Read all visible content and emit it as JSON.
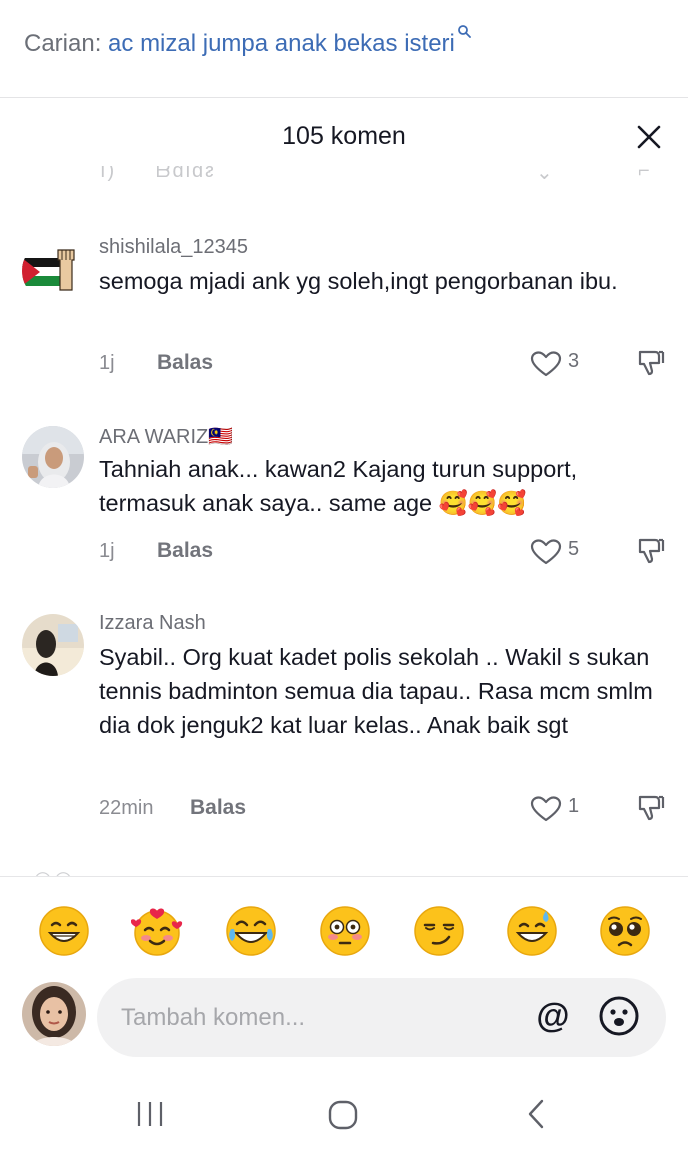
{
  "search": {
    "prefix": "Carian:",
    "query": "ac mizal jumpa anak bekas isteri",
    "icon": "search-icon"
  },
  "sheet": {
    "title": "105 komen",
    "close_icon": "close-icon"
  },
  "comments": [
    {
      "username": "shishilala_12345",
      "text": "semoga mjadi ank yg soleh,ingt pengorbanan ibu.",
      "time": "1j",
      "reply_label": "Balas",
      "likes": "3"
    },
    {
      "username": "ARA WARIZ🇲🇾",
      "text": "Tahniah anak... kawan2 Kajang turun support, termasuk anak saya.. same age 🥰🥰🥰",
      "time": "1j",
      "reply_label": "Balas",
      "likes": "5"
    },
    {
      "username": "Izzara Nash",
      "text": "Syabil.. Org kuat kadet polis sekolah .. Wakil s sukan tennis badminton semua dia tapau.. Rasa mcm smlm dia dok jenguk2 kat luar kelas.. Anak baik sgt",
      "time": "22min",
      "reply_label": "Balas",
      "likes": "1"
    }
  ],
  "emoji_bar": [
    "grinning-face",
    "smiling-face-with-hearts",
    "tears-of-joy",
    "flushed-face",
    "smirking-face",
    "grinning-sweat",
    "pleading-face"
  ],
  "composer": {
    "placeholder": "Tambah komen...",
    "mention_label": "@"
  },
  "colors": {
    "query_link": "#3d6cb5",
    "muted_text": "#6c6e75",
    "composer_bg": "#f1f1f2"
  }
}
